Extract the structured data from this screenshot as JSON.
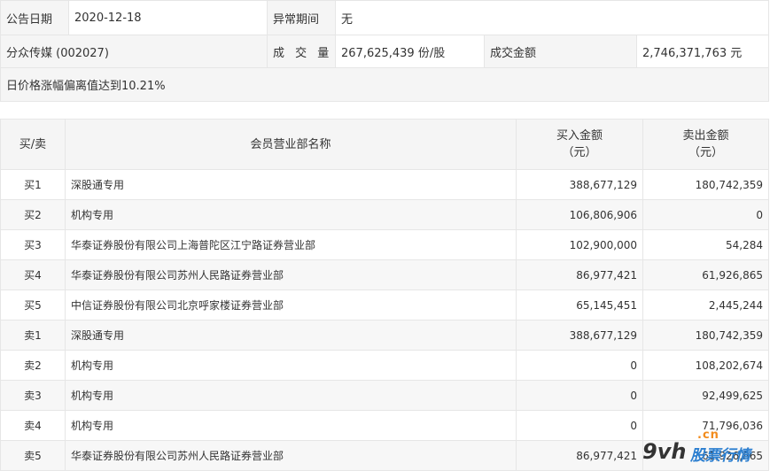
{
  "info": {
    "date_label": "公告日期",
    "date_value": "2020-12-18",
    "abnormal_label": "异常期间",
    "abnormal_value": "无",
    "stock_name": "分众传媒 (002027)",
    "volume_label": "成 交 量",
    "volume_value": "267,625,439 份/股",
    "amount_label": "成交金额",
    "amount_value": "2,746,371,763 元",
    "reason": "日价格涨幅偏离值达到10.21%"
  },
  "trades": {
    "headers": {
      "type": "买/卖",
      "name": "会员营业部名称",
      "buy_line1": "买入金额",
      "buy_line2": "（元）",
      "sell_line1": "卖出金额",
      "sell_line2": "（元）"
    },
    "rows": [
      {
        "type": "买1",
        "name": "深股通专用",
        "buy": "388,677,129",
        "sell": "180,742,359"
      },
      {
        "type": "买2",
        "name": "机构专用",
        "buy": "106,806,906",
        "sell": "0"
      },
      {
        "type": "买3",
        "name": "华泰证券股份有限公司上海普陀区江宁路证券营业部",
        "buy": "102,900,000",
        "sell": "54,284"
      },
      {
        "type": "买4",
        "name": "华泰证券股份有限公司苏州人民路证券营业部",
        "buy": "86,977,421",
        "sell": "61,926,865"
      },
      {
        "type": "买5",
        "name": "中信证券股份有限公司北京呼家楼证券营业部",
        "buy": "65,145,451",
        "sell": "2,445,244"
      },
      {
        "type": "卖1",
        "name": "深股通专用",
        "buy": "388,677,129",
        "sell": "180,742,359"
      },
      {
        "type": "卖2",
        "name": "机构专用",
        "buy": "0",
        "sell": "108,202,674"
      },
      {
        "type": "卖3",
        "name": "机构专用",
        "buy": "0",
        "sell": "92,499,625"
      },
      {
        "type": "卖4",
        "name": "机构专用",
        "buy": "0",
        "sell": "71,796,036"
      },
      {
        "type": "卖5",
        "name": "华泰证券股份有限公司苏州人民路证券营业部",
        "buy": "86,977,421",
        "sell": "61,926,865"
      }
    ]
  },
  "watermark": {
    "logo_main": "9vh",
    "logo_domain": ".cn",
    "logo_text": "股票行情",
    "colors": {
      "orange": "#f28c1e",
      "blue": "#2c7fd0"
    }
  }
}
